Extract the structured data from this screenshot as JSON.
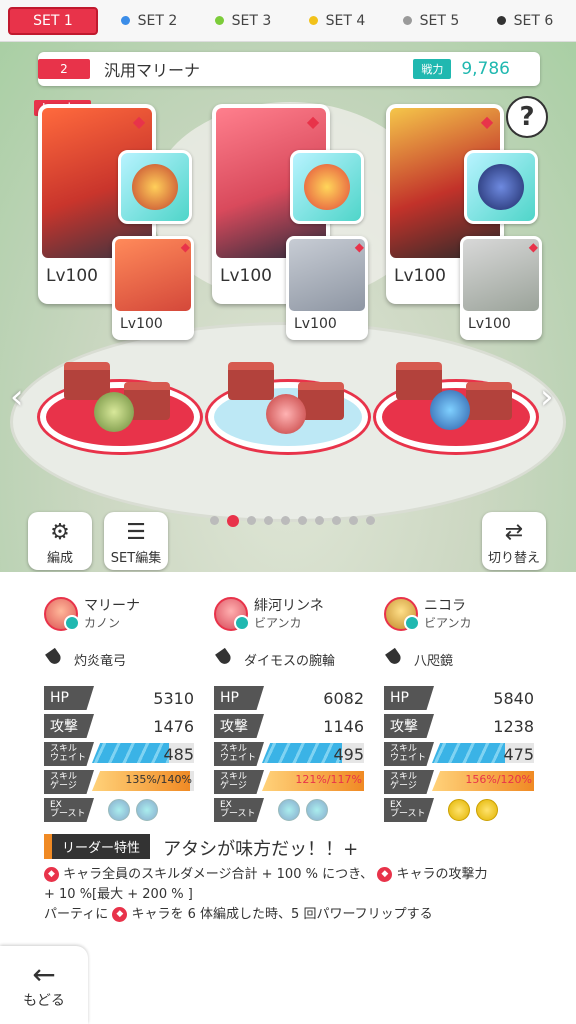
{
  "set_tabs": [
    {
      "label": "SET 1",
      "color": "#e8334a"
    },
    {
      "label": "SET 2",
      "color": "#3b8de8"
    },
    {
      "label": "SET 3",
      "color": "#7ccc3a"
    },
    {
      "label": "SET 4",
      "color": "#f2c21b"
    },
    {
      "label": "SET 5",
      "color": "#9a9a9a"
    },
    {
      "label": "SET 6",
      "color": "#333333"
    }
  ],
  "team": {
    "number": "2",
    "name": "汎用マリーナ",
    "power_label": "戦力",
    "power": "9,786"
  },
  "leader_badge": "Leader",
  "cards": [
    {
      "lv": "Lv100",
      "sub_lv": "Lv100",
      "equip_color": "#c2432f"
    },
    {
      "lv": "Lv100",
      "sub_lv": "Lv100",
      "equip_color": "#e24a3b"
    },
    {
      "lv": "Lv100",
      "sub_lv": "Lv100",
      "equip_color": "#2b3a8c"
    }
  ],
  "buttons": {
    "formation": "編成",
    "set_edit": "SET編集",
    "switch": "切り替え",
    "back": "もどる"
  },
  "pager": {
    "count": 10,
    "active": 1
  },
  "columns": [
    {
      "name": "マリーナ",
      "sub": "カノン",
      "weapon": "灼炎竜弓",
      "hp_label": "HP",
      "hp": "5310",
      "atk_label": "攻撃",
      "atk": "1476",
      "wait_label1": "スキル",
      "wait_label2": "ウェイト",
      "wait": "485",
      "wait_fill": 0.75,
      "gauge_label1": "スキル",
      "gauge_label2": "ゲージ",
      "gauge": "135%/140%",
      "gauge_fill": 0.96,
      "ex_label1": "EX",
      "ex_label2": "ブースト",
      "ex_icons": [
        "skill",
        "skill"
      ]
    },
    {
      "name": "緋河リンネ",
      "sub": "ビアンカ",
      "weapon": "ダイモスの腕輪",
      "hp_label": "HP",
      "hp": "6082",
      "atk_label": "攻撃",
      "atk": "1146",
      "wait_label1": "スキル",
      "wait_label2": "ウェイト",
      "wait": "495",
      "wait_fill": 0.78,
      "gauge_label1": "スキル",
      "gauge_label2": "ゲージ",
      "gauge": "121%/117%",
      "gauge_fill": 1.0,
      "ex_label1": "EX",
      "ex_label2": "ブースト",
      "ex_icons": [
        "skill",
        "skill"
      ]
    },
    {
      "name": "ニコラ",
      "sub": "ビアンカ",
      "weapon": "八咫鏡",
      "hp_label": "HP",
      "hp": "5840",
      "atk_label": "攻撃",
      "atk": "1238",
      "wait_label1": "スキル",
      "wait_label2": "ウェイト",
      "wait": "475",
      "wait_fill": 0.72,
      "gauge_label1": "スキル",
      "gauge_label2": "ゲージ",
      "gauge": "156%/120%",
      "gauge_fill": 1.0,
      "ex_label1": "EX",
      "ex_label2": "ブースト",
      "ex_icons": [
        "gold",
        "gold"
      ]
    }
  ],
  "leader_skill": {
    "label": "リーダー特性",
    "title": "アタシが味方だッ！！+",
    "line1": "キャラ全員のスキルダメージ合計 + 100 % につき、",
    "line1b": "キャラの攻撃力",
    "line2": "+ 10 %[最大 + 200 % ]",
    "line3a": "パーティに",
    "line3b": "キャラを 6 体編成した時、5 回パワーフリップする"
  },
  "colors": {
    "accent": "#e8334a",
    "teal": "#20b8b0",
    "wait_bar": "#3ab3e6",
    "gauge_bar": "#f08a24"
  }
}
